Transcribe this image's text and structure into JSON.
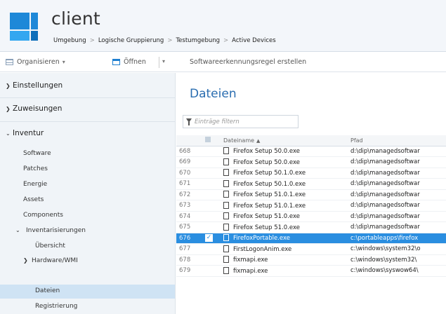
{
  "header": {
    "title": "client",
    "breadcrumb": [
      "Umgebung",
      "Logische Gruppierung",
      "Testumgebung",
      "Active Devices"
    ]
  },
  "toolbar": {
    "organize_label": "Organisieren",
    "open_label": "Öffnen",
    "action_label": "Softwareerkennungsregel erstellen"
  },
  "sidebar": {
    "sections": {
      "settings": "Einstellungen",
      "assignments": "Zuweisungen",
      "inventory": "Inventur"
    },
    "inventory_items": {
      "software": "Software",
      "patches": "Patches",
      "energy": "Energie",
      "assets": "Assets",
      "components": "Components",
      "inventories": "Inventarisierungen",
      "overview": "Übersicht",
      "hardware": "Hardware/WMI",
      "files": "Dateien",
      "registry": "Registrierung"
    }
  },
  "main": {
    "title": "Dateien",
    "filter_placeholder": "Einträge filtern",
    "columns": {
      "filename": "Dateiname",
      "path": "Pfad"
    },
    "rows": [
      {
        "num": "668",
        "name": "Firefox Setup 50.0.exe",
        "path": "d:\\dip\\managedsoftwar"
      },
      {
        "num": "669",
        "name": "Firefox Setup 50.0.exe",
        "path": "d:\\dip\\managedsoftwar"
      },
      {
        "num": "670",
        "name": "Firefox Setup 50.1.0.exe",
        "path": "d:\\dip\\managedsoftwar"
      },
      {
        "num": "671",
        "name": "Firefox Setup 50.1.0.exe",
        "path": "d:\\dip\\managedsoftwar"
      },
      {
        "num": "672",
        "name": "Firefox Setup 51.0.1.exe",
        "path": "d:\\dip\\managedsoftwar"
      },
      {
        "num": "673",
        "name": "Firefox Setup 51.0.1.exe",
        "path": "d:\\dip\\managedsoftwar"
      },
      {
        "num": "674",
        "name": "Firefox Setup 51.0.exe",
        "path": "d:\\dip\\managedsoftwar"
      },
      {
        "num": "675",
        "name": "Firefox Setup 51.0.exe",
        "path": "d:\\dip\\managedsoftwar"
      },
      {
        "num": "676",
        "name": "FirefoxPortable.exe",
        "path": "c:\\portableapps\\firefox"
      },
      {
        "num": "677",
        "name": "FirstLogonAnim.exe",
        "path": "c:\\windows\\system32\\o"
      },
      {
        "num": "678",
        "name": "fixmapi.exe",
        "path": "c:\\windows\\system32\\"
      },
      {
        "num": "679",
        "name": "fixmapi.exe",
        "path": "c:\\windows\\syswow64\\"
      }
    ],
    "selected_row": "676"
  },
  "colors": {
    "accent": "#2a8ee0",
    "title_blue": "#2a6db0",
    "sidebar_bg": "#f0f4f8",
    "active_item": "#cfe3f4"
  }
}
